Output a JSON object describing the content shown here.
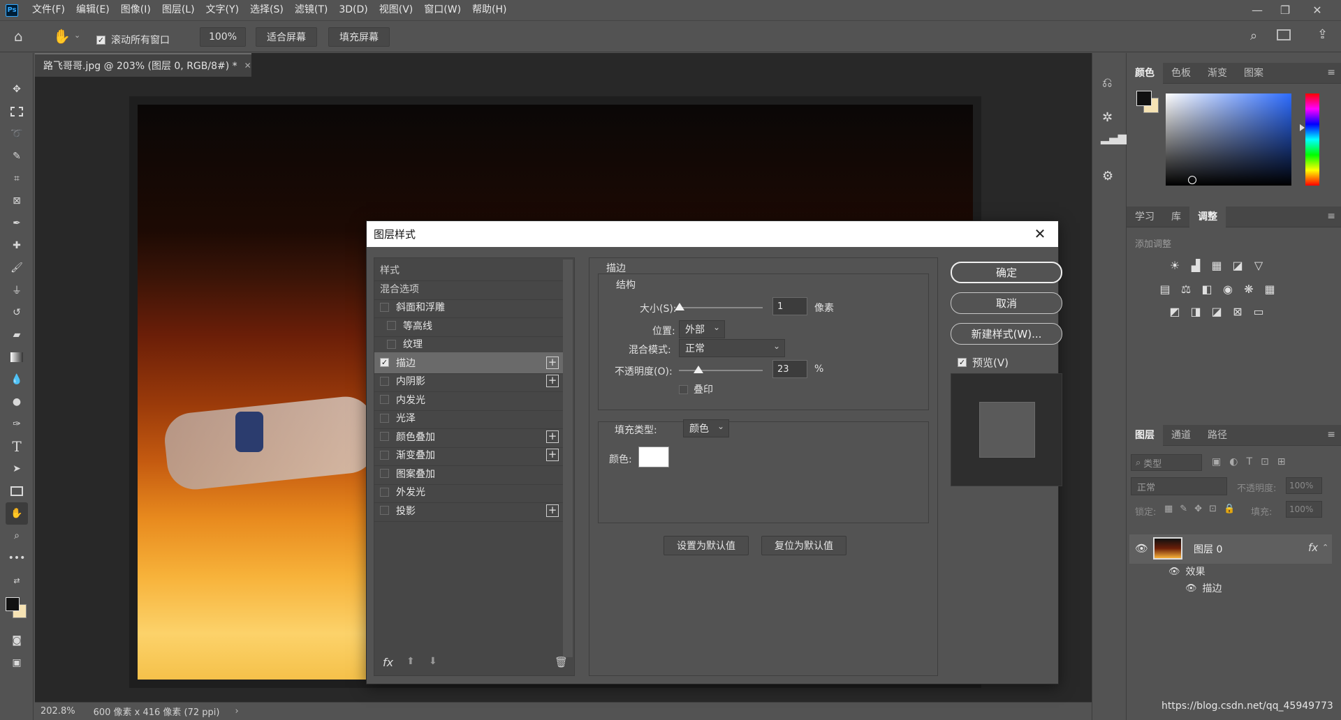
{
  "menubar": {
    "logo": "Ps",
    "items": [
      "文件(F)",
      "编辑(E)",
      "图像(I)",
      "图层(L)",
      "文字(Y)",
      "选择(S)",
      "滤镜(T)",
      "3D(D)",
      "视图(V)",
      "窗口(W)",
      "帮助(H)"
    ]
  },
  "optionsbar": {
    "scroll_all_windows": "滚动所有窗口",
    "zoom": "100%",
    "fit_screen": "适合屏幕",
    "fill_screen": "填充屏幕"
  },
  "document": {
    "tab_title": "路飞哥哥.jpg @ 203% (图层 0, RGB/8#) *",
    "zoom_status": "202.8%",
    "size_status": "600 像素 x 416 像素 (72 ppi)"
  },
  "panels": {
    "color_tabs": [
      "颜色",
      "色板",
      "渐变",
      "图案"
    ],
    "adjust_tabs": [
      "学习",
      "库",
      "调整"
    ],
    "add_adjustment": "添加调整",
    "layers_tabs": [
      "图层",
      "通道",
      "路径"
    ],
    "layers": {
      "search_placeholder": "类型",
      "blend_mode": "正常",
      "opacity_label": "不透明度:",
      "opacity_value": "100%",
      "lock_label": "锁定:",
      "fill_label": "填充:",
      "fill_value": "100%",
      "layer_name": "图层 0",
      "fx": "fx",
      "effects_label": "效果",
      "stroke_label": "描边"
    }
  },
  "dialog": {
    "title": "图层样式",
    "styles": [
      {
        "label": "样式",
        "type": "header"
      },
      {
        "label": "混合选项",
        "type": "header"
      },
      {
        "label": "斜面和浮雕",
        "checked": false,
        "indent": false,
        "plus": false
      },
      {
        "label": "等高线",
        "checked": false,
        "indent": true,
        "plus": false
      },
      {
        "label": "纹理",
        "checked": false,
        "indent": true,
        "plus": false
      },
      {
        "label": "描边",
        "checked": true,
        "indent": false,
        "plus": true,
        "selected": true
      },
      {
        "label": "内阴影",
        "checked": false,
        "indent": false,
        "plus": true
      },
      {
        "label": "内发光",
        "checked": false,
        "indent": false,
        "plus": false
      },
      {
        "label": "光泽",
        "checked": false,
        "indent": false,
        "plus": false
      },
      {
        "label": "颜色叠加",
        "checked": false,
        "indent": false,
        "plus": true
      },
      {
        "label": "渐变叠加",
        "checked": false,
        "indent": false,
        "plus": true
      },
      {
        "label": "图案叠加",
        "checked": false,
        "indent": false,
        "plus": false
      },
      {
        "label": "外发光",
        "checked": false,
        "indent": false,
        "plus": false
      },
      {
        "label": "投影",
        "checked": false,
        "indent": false,
        "plus": true
      }
    ],
    "fx_label": "fx",
    "stroke": {
      "section": "描边",
      "structure": "结构",
      "size_label": "大小(S):",
      "size_value": "1",
      "size_unit": "像素",
      "position_label": "位置:",
      "position_value": "外部",
      "blend_label": "混合模式:",
      "blend_value": "正常",
      "opacity_label": "不透明度(O):",
      "opacity_value": "23",
      "opacity_unit": "%",
      "overprint": "叠印",
      "fill_type_label": "填充类型:",
      "fill_type_value": "颜色",
      "color_label": "颜色:",
      "stroke_color": "#ffffff"
    },
    "set_default": "设置为默认值",
    "reset_default": "复位为默认值",
    "ok": "确定",
    "cancel": "取消",
    "new_style": "新建样式(W)...",
    "preview": "预览(V)"
  },
  "watermark": "https://blog.csdn.net/qq_45949773"
}
